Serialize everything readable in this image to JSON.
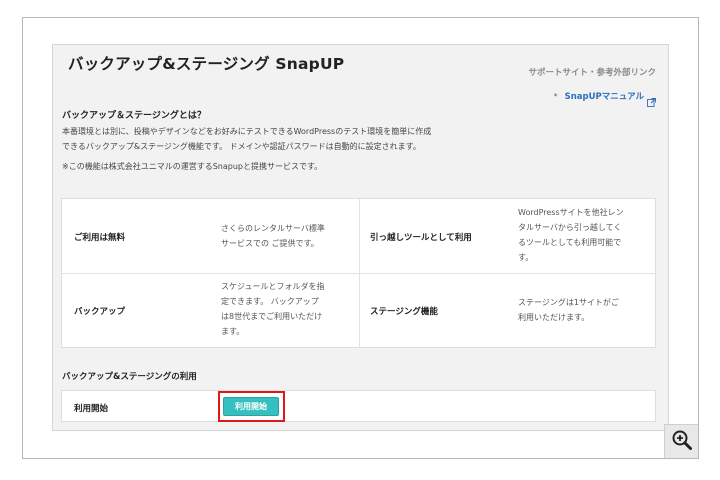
{
  "title": "バックアップ&ステージング SnapUP",
  "side_links": {
    "heading": "サポートサイト・参考外部リンク",
    "bullet": "*",
    "manual_link": "SnapUPマニュアル",
    "manual_icon": "external-link-icon"
  },
  "about": {
    "heading": "バックアップ＆ステージングとは？",
    "line1": "本番環境とは別に、投稿やデザインなどをお好みにテストできるWordPressのテスト環境を簡単に作成",
    "line2": "できるバックアップ&ステージング機能です。 ドメインや認証パスワードは自動的に設定されます。",
    "note": "※この機能は株式会社ユニマルの運営するSnapupと提携サービスです。"
  },
  "features": [
    {
      "label": "ご利用は無料",
      "lines": [
        "さくらのレンタルサーバ標準",
        "サービスでの ご提供です。"
      ]
    },
    {
      "label": "引っ越しツールとして利用",
      "lines": [
        "WordPressサイトを他社レン",
        "タルサーバから引っ越してく",
        "るツールとしても利用可能で",
        "す。"
      ]
    },
    {
      "label": "バックアップ",
      "lines": [
        "スケジュールとフォルダを指",
        "定できます。 バックアップ",
        "は8世代までご利用いただけ",
        "ます。"
      ]
    },
    {
      "label": "ステージング機能",
      "lines": [
        "ステージングは1サイトがご",
        "利用いただけます。"
      ]
    }
  ],
  "usage": {
    "heading": "バックアップ&ステージングの利用",
    "row_label": "利用開始",
    "button_label": "利用開始"
  },
  "colors": {
    "button": "#35bfbf",
    "link": "#2a6ebd",
    "highlight": "#e0161b"
  },
  "zoom_icon": "zoom-in-icon"
}
